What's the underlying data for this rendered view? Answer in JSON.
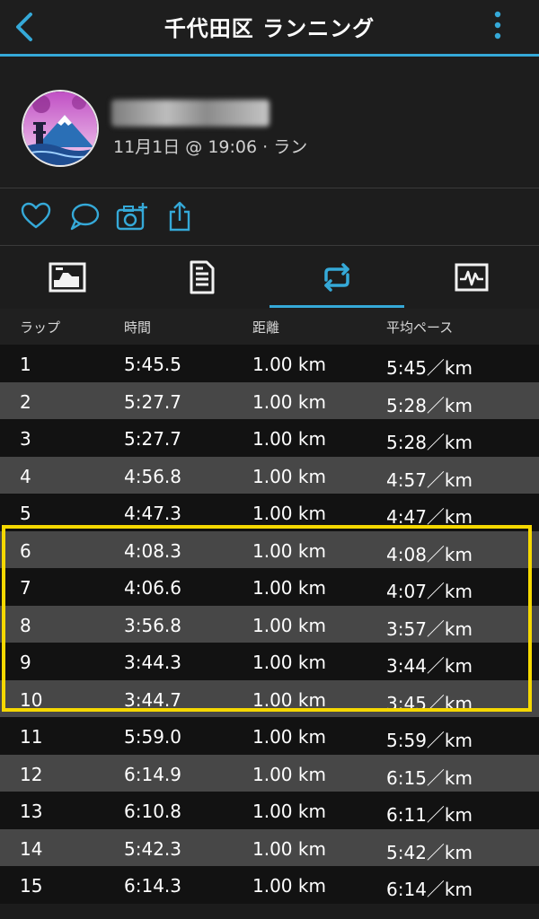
{
  "header": {
    "title": "千代田区 ランニング",
    "back_icon": "chevron-left-icon",
    "more_icon": "more-vertical-icon",
    "accent_color": "#35a9d8"
  },
  "activity": {
    "meta": "11月1日 @ 19:06 · ラン"
  },
  "actions": [
    {
      "icon": "heart-icon"
    },
    {
      "icon": "comment-icon"
    },
    {
      "icon": "add-photo-icon"
    },
    {
      "icon": "share-icon"
    }
  ],
  "tabs": [
    {
      "icon": "summary-chart-icon",
      "selected": false
    },
    {
      "icon": "details-list-icon",
      "selected": false
    },
    {
      "icon": "laps-icon",
      "selected": true
    },
    {
      "icon": "graphs-icon",
      "selected": false
    }
  ],
  "table": {
    "headers": [
      "ラップ",
      "時間",
      "距離",
      "平均ペース"
    ],
    "rows": [
      [
        "1",
        "5:45.5",
        "1.00 km",
        "5:45／km"
      ],
      [
        "2",
        "5:27.7",
        "1.00 km",
        "5:28／km"
      ],
      [
        "3",
        "5:27.7",
        "1.00 km",
        "5:28／km"
      ],
      [
        "4",
        "4:56.8",
        "1.00 km",
        "4:57／km"
      ],
      [
        "5",
        "4:47.3",
        "1.00 km",
        "4:47／km"
      ],
      [
        "6",
        "4:08.3",
        "1.00 km",
        "4:08／km"
      ],
      [
        "7",
        "4:06.6",
        "1.00 km",
        "4:07／km"
      ],
      [
        "8",
        "3:56.8",
        "1.00 km",
        "3:57／km"
      ],
      [
        "9",
        "3:44.3",
        "1.00 km",
        "3:44／km"
      ],
      [
        "10",
        "3:44.7",
        "1.00 km",
        "3:45／km"
      ],
      [
        "11",
        "5:59.0",
        "1.00 km",
        "5:59／km"
      ],
      [
        "12",
        "6:14.9",
        "1.00 km",
        "6:15／km"
      ],
      [
        "13",
        "6:10.8",
        "1.00 km",
        "6:11／km"
      ],
      [
        "14",
        "5:42.3",
        "1.00 km",
        "5:42／km"
      ],
      [
        "15",
        "6:14.3",
        "1.00 km",
        "6:14／km"
      ]
    ]
  },
  "highlight": {
    "color": "#f5d800",
    "laps": "6-10"
  }
}
